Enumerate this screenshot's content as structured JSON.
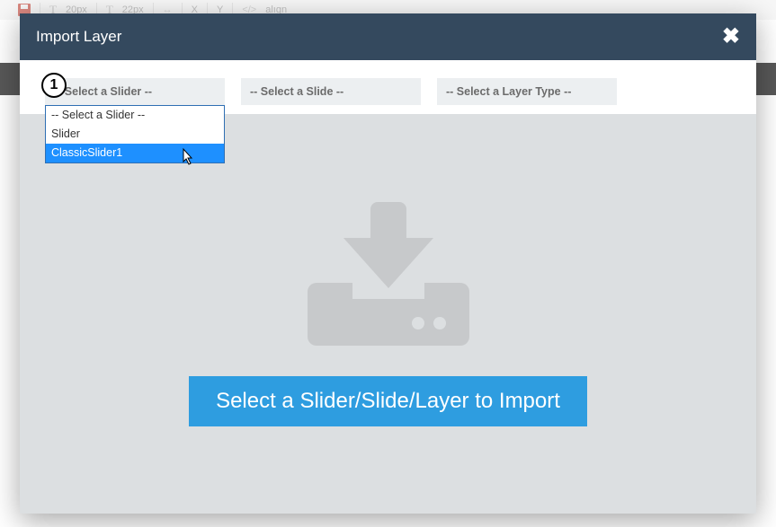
{
  "modal": {
    "title": "Import Layer"
  },
  "step_badge": "1",
  "selectors": {
    "slider": {
      "placeholder": "-- Select a Slider --"
    },
    "slide": {
      "placeholder": "-- Select a Slide --"
    },
    "layer_type": {
      "placeholder": "-- Select a Layer Type --"
    }
  },
  "slider_dropdown": {
    "options": [
      {
        "label": "-- Select a Slider --",
        "hovered": false
      },
      {
        "label": "Slider",
        "hovered": false
      },
      {
        "label": "ClassicSlider1",
        "hovered": true
      }
    ]
  },
  "cta": {
    "label": "Select a Slider/Slide/Layer to Import"
  },
  "toolbar_hint": {
    "t1": "T",
    "size1": "20px",
    "t2": "T",
    "size2": "22px",
    "x": "X",
    "y": "Y",
    "align": "alıgn"
  }
}
